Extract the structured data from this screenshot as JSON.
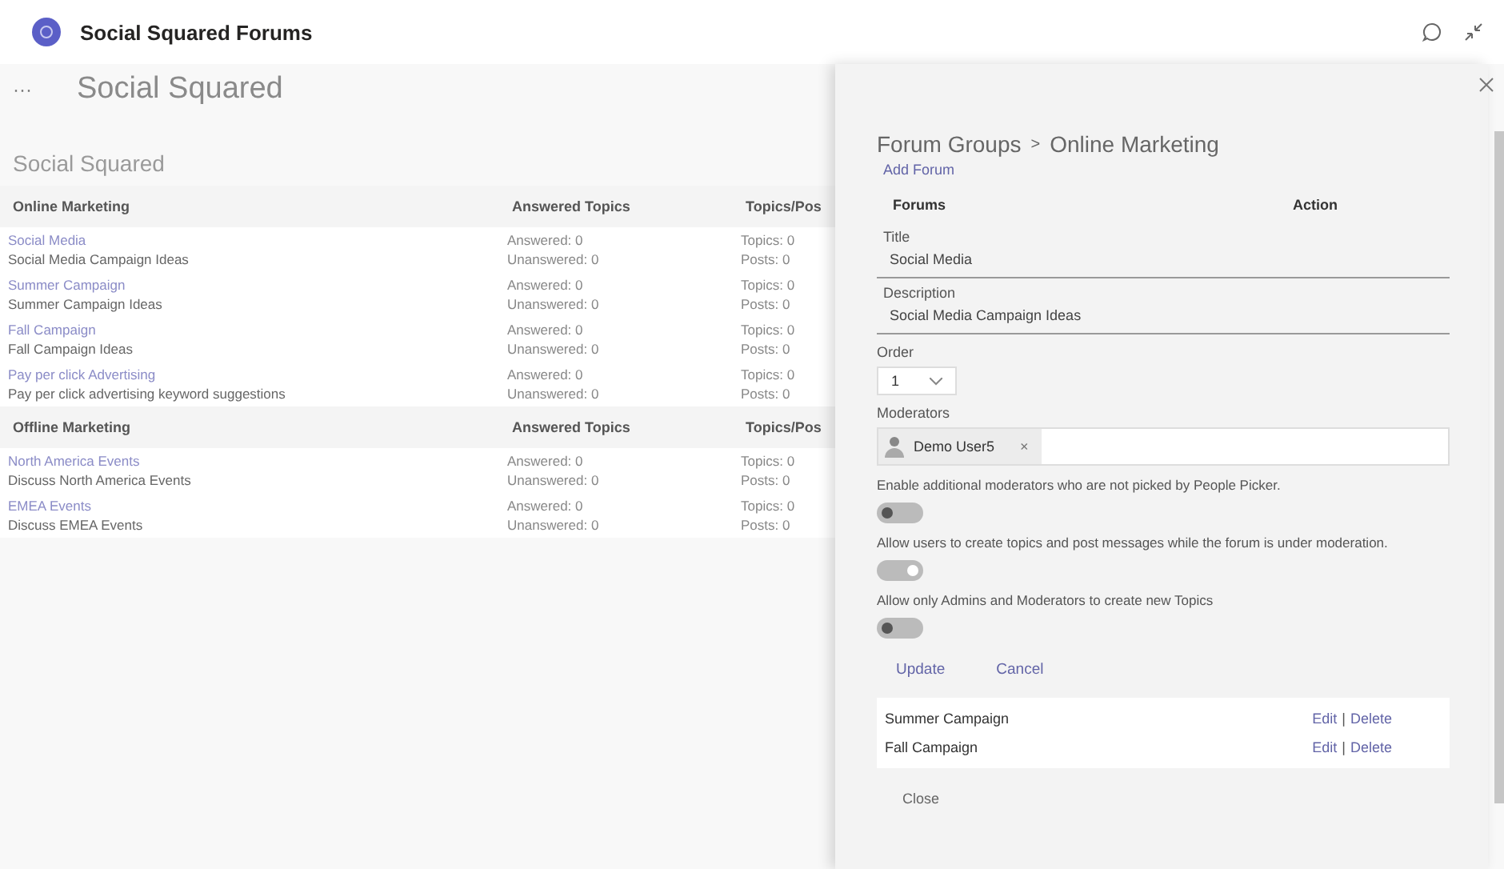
{
  "app_bar": {
    "title": "Social Squared Forums"
  },
  "page": {
    "more": "···",
    "title": "Social Squared"
  },
  "forum_list": {
    "title": "Social Squared",
    "groups": [
      {
        "columns": [
          "Online Marketing",
          "Answered Topics",
          "Topics/Pos"
        ],
        "forums": [
          {
            "name": "Social Media",
            "description": "Social Media Campaign Ideas",
            "answered": "Answered: 0",
            "unanswered": "Unanswered: 0",
            "topics": "Topics: 0",
            "posts": "Posts: 0"
          },
          {
            "name": "Summer Campaign",
            "description": "Summer Campaign Ideas",
            "answered": "Answered: 0",
            "unanswered": "Unanswered: 0",
            "topics": "Topics: 0",
            "posts": "Posts: 0"
          },
          {
            "name": "Fall Campaign",
            "description": "Fall Campaign Ideas",
            "answered": "Answered: 0",
            "unanswered": "Unanswered: 0",
            "topics": "Topics: 0",
            "posts": "Posts: 0"
          },
          {
            "name": "Pay per click Advertising",
            "description": "Pay per click advertising keyword suggestions",
            "answered": "Answered: 0",
            "unanswered": "Unanswered: 0",
            "topics": "Topics: 0",
            "posts": "Posts: 0"
          }
        ]
      },
      {
        "columns": [
          "Offline Marketing",
          "Answered Topics",
          "Topics/Pos"
        ],
        "forums": [
          {
            "name": "North America Events",
            "description": "Discuss North America Events",
            "answered": "Answered: 0",
            "unanswered": "Unanswered: 0",
            "topics": "Topics: 0",
            "posts": "Posts: 0"
          },
          {
            "name": "EMEA Events",
            "description": "Discuss EMEA Events",
            "answered": "Answered: 0",
            "unanswered": "Unanswered: 0",
            "topics": "Topics: 0",
            "posts": "Posts: 0"
          }
        ]
      }
    ]
  },
  "panel": {
    "breadcrumb": [
      "Forum Groups",
      "Online Marketing"
    ],
    "separator": ">",
    "add_link": "Add Forum",
    "columns": [
      "Forums",
      "Action"
    ],
    "title_field": {
      "label": "Title",
      "value": "Social Media"
    },
    "description_field": {
      "label": "Description",
      "value": "Social Media Campaign Ideas"
    },
    "order_field": {
      "label": "Order",
      "value": "1"
    },
    "moderators": {
      "label": "Moderators",
      "people": [
        {
          "name": "Demo User5",
          "remove": "×"
        }
      ]
    },
    "toggles": [
      {
        "label": "Enable additional moderators who are not picked by People Picker.",
        "on": false
      },
      {
        "label": "Allow users to create topics and post messages while the forum is under moderation.",
        "on": true
      },
      {
        "label": "Allow only Admins and Moderators to create new Topics",
        "on": false
      }
    ],
    "buttons": [
      "Update",
      "Cancel"
    ],
    "forums": [
      {
        "name": "Summer Campaign",
        "edit": "Edit",
        "sep": "|",
        "delete": "Delete"
      },
      {
        "name": "Fall Campaign",
        "edit": "Edit",
        "sep": "|",
        "delete": "Delete"
      }
    ],
    "close": "Close"
  }
}
